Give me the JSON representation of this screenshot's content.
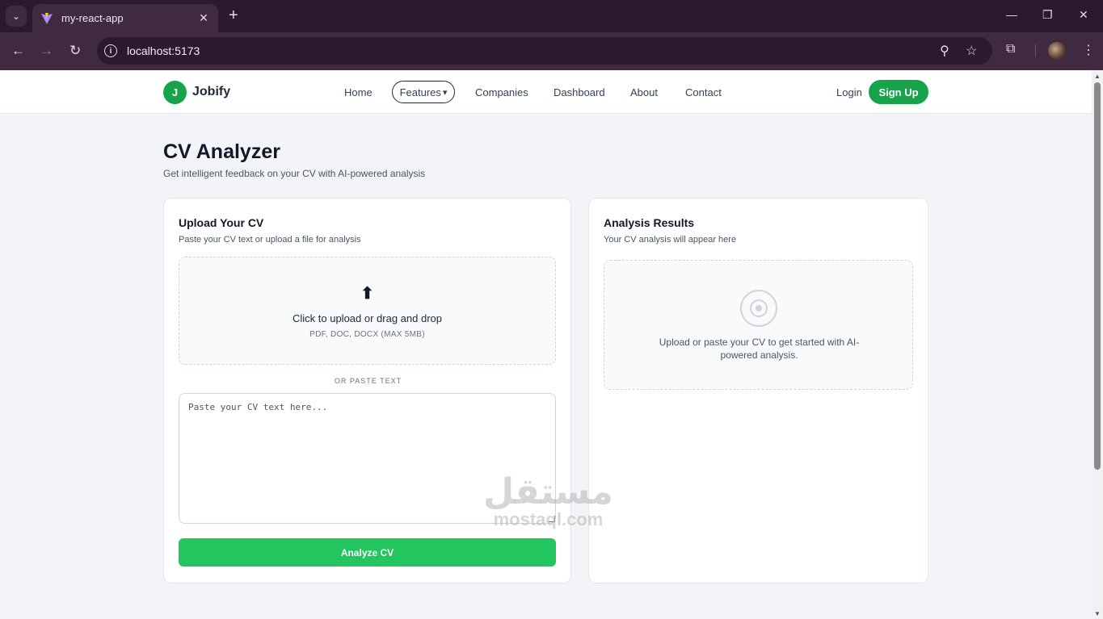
{
  "browser": {
    "tab_title": "my-react-app",
    "url": "localhost:5173"
  },
  "nav": {
    "logo_letter": "J",
    "brand": "Jobify",
    "links": [
      "Home",
      "Features",
      "Companies",
      "Dashboard",
      "About",
      "Contact"
    ],
    "features_arrow": "▾",
    "login": "Login",
    "signup": "Sign Up"
  },
  "header": {
    "title": "CV Analyzer",
    "subtitle": "Get intelligent feedback on your CV with AI-powered analysis"
  },
  "upload_card": {
    "title": "Upload Your CV",
    "subtitle": "Paste your CV text or upload a file for analysis",
    "upload_icon": "⬆",
    "dropzone_text": "Click to upload or drag and drop",
    "dropzone_formats": "PDF, DOC, DOCX (MAX 5MB)",
    "or_text": "OR PASTE TEXT",
    "textarea_placeholder": "Paste your CV text here...",
    "analyze_label": "Analyze CV"
  },
  "results_card": {
    "title": "Analysis Results",
    "subtitle": "Your CV analysis will appear here",
    "empty_text": "Upload or paste your CV to get started with AI-powered analysis."
  },
  "watermark": {
    "arabic": "مستقل",
    "latin": "mostaql.com"
  }
}
